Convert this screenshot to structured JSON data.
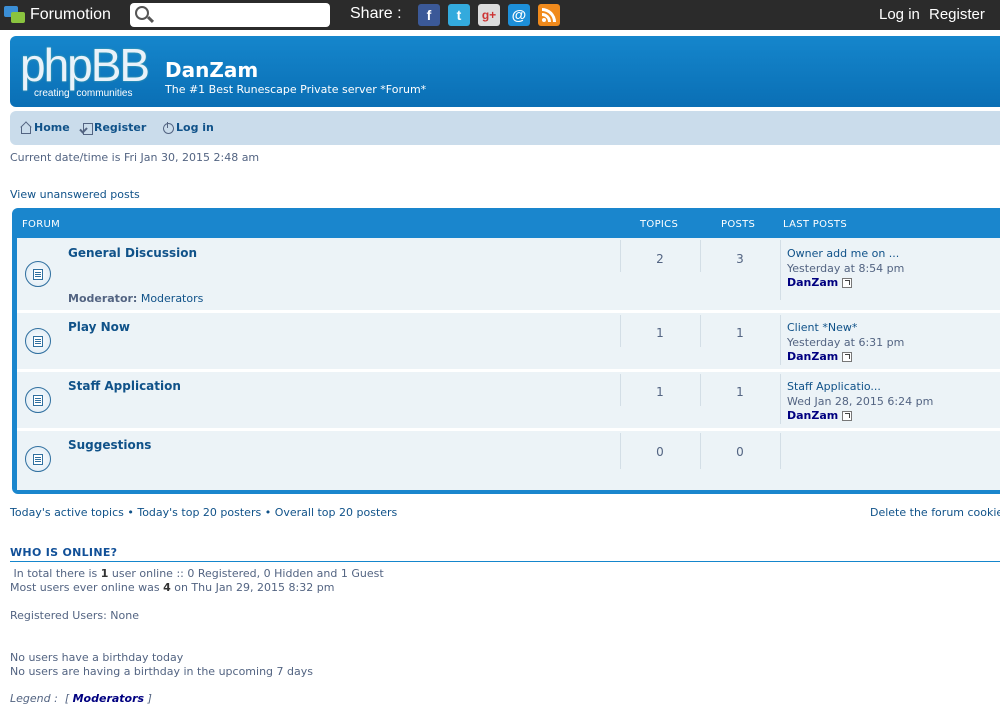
{
  "topbar": {
    "brand": "Forumotion",
    "search_placeholder": "",
    "share_label": "Share :",
    "share_icons": [
      "facebook-icon",
      "twitter-icon",
      "google-plus-icon",
      "email-icon",
      "rss-icon"
    ],
    "login": "Log in",
    "register": "Register"
  },
  "header": {
    "logo_word": "phpBB",
    "logo_tag1": "creating",
    "logo_tag2": "communities",
    "site_title": "DanZam",
    "site_desc": "The #1 Best Runescape Private server *Forum*"
  },
  "nav": {
    "home": "Home",
    "register": "Register",
    "login": "Log in"
  },
  "datetime": "Current date/time is Fri Jan 30, 2015 2:48 am",
  "unanswered": "View unanswered posts",
  "forum_table": {
    "headers": {
      "forum": "FORUM",
      "topics": "TOPICS",
      "posts": "POSTS",
      "last_posts": "LAST POSTS"
    },
    "rows": [
      {
        "title": "General Discussion",
        "moderator_label": "Moderator:",
        "moderator": "Moderators",
        "topics": "2",
        "posts": "3",
        "last_title": "Owner add me on ...",
        "last_date": "Yesterday at 8:54 pm",
        "last_user": "DanZam"
      },
      {
        "title": "Play Now",
        "topics": "1",
        "posts": "1",
        "last_title": "Client *New*",
        "last_date": "Yesterday at 6:31 pm",
        "last_user": "DanZam"
      },
      {
        "title": "Staff Application",
        "topics": "1",
        "posts": "1",
        "last_title": "Staff Applicatio...",
        "last_date": "Wed Jan 28, 2015 6:24 pm",
        "last_user": "DanZam"
      },
      {
        "title": "Suggestions",
        "topics": "0",
        "posts": "0"
      }
    ]
  },
  "footer": {
    "active_topics": "Today's active topics",
    "sep": " • ",
    "top20_today": "Today's top 20 posters",
    "top20_overall": "Overall top 20 posters",
    "delete_cookies": "Delete the forum cookies"
  },
  "who_is_online": {
    "title": "WHO IS ONLINE?",
    "total_pre": " In total there is ",
    "total_count": "1",
    "total_post": " user online :: 0 Registered, 0 Hidden and 1 Guest",
    "most_pre": "Most users ever online was ",
    "most_count": "4",
    "most_post": " on Thu Jan 29, 2015 8:32 pm",
    "registered": "Registered Users: None",
    "birthday_today": "No users have a birthday today",
    "birthday_week": "No users are having a birthday in the upcoming 7 days",
    "legend_label": "Legend :",
    "legend_open": "[",
    "legend_item": "Moderators",
    "legend_close": "]"
  }
}
